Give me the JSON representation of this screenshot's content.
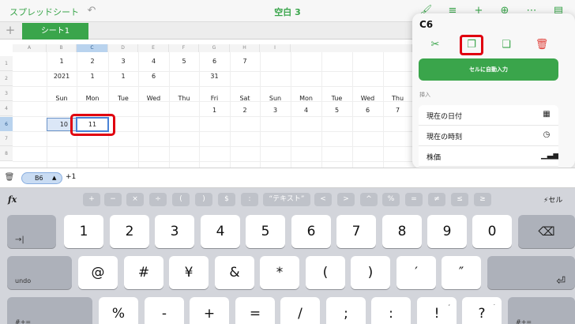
{
  "topbar": {
    "back_label": "スプレッドシート",
    "undo_icon": "undo-icon",
    "title": "空白 3",
    "icons": [
      "paintbrush-icon",
      "list-icon",
      "plus-icon",
      "share-icon",
      "more-icon",
      "sidebar-icon"
    ]
  },
  "tabs": {
    "add_label": "+",
    "active_sheet": "シート1"
  },
  "grid": {
    "columns": [
      "A",
      "B",
      "C",
      "D",
      "E",
      "F",
      "G",
      "H",
      "I"
    ],
    "selected_column": "C",
    "rows": [
      "1",
      "2",
      "3",
      "4",
      "5",
      "6",
      "7",
      "8"
    ],
    "selected_row": "6",
    "row1": [
      "1",
      "2",
      "3",
      "4",
      "5",
      "6",
      "7"
    ],
    "row2": [
      "2021",
      "1",
      "1",
      "6",
      "",
      "31"
    ],
    "row4": [
      "Sun",
      "Mon",
      "Tue",
      "Wed",
      "Thu",
      "Fri",
      "Sat",
      "Sun",
      "Mon",
      "Tue",
      "Wed",
      "Thu"
    ],
    "row5": [
      "1",
      "2",
      "3",
      "4",
      "5",
      "6",
      "7"
    ],
    "b6": "10",
    "c6": "11"
  },
  "popover": {
    "title": "C6",
    "autofill_label": "セルに自動入力",
    "insert_label": "挿入",
    "items": [
      {
        "label": "現在の日付",
        "icon": "calendar-icon"
      },
      {
        "label": "現在の時刻",
        "icon": "clock-icon"
      },
      {
        "label": "株価",
        "icon": "stock-chart-icon"
      }
    ]
  },
  "formula": {
    "ref": "B6",
    "caret": "▲",
    "tail": "+1"
  },
  "keyboard": {
    "ops": [
      "+",
      "−",
      "×",
      "÷",
      "(",
      ")",
      "$",
      ":",
      "“テキスト”",
      "<",
      ">",
      "^",
      "%",
      "=",
      "≠",
      "≤",
      "≥"
    ],
    "cell_label": "セル",
    "row1": [
      "1",
      "2",
      "3",
      "4",
      "5",
      "6",
      "7",
      "8",
      "9",
      "0"
    ],
    "row2": [
      "@",
      "#",
      "¥",
      "&",
      "*",
      "(",
      ")",
      "′",
      "″"
    ],
    "row3": [
      "%",
      "-",
      "+",
      "=",
      "/",
      ";",
      ":",
      "!",
      "?"
    ],
    "tab_label": "→|",
    "undo_label": "undo",
    "delete_label": "⌫",
    "return_label": "⏎",
    "row3_left": "#+=",
    "row3_sub": [
      "",
      "",
      "",
      "",
      "",
      "",
      "",
      ",",
      "."
    ]
  }
}
